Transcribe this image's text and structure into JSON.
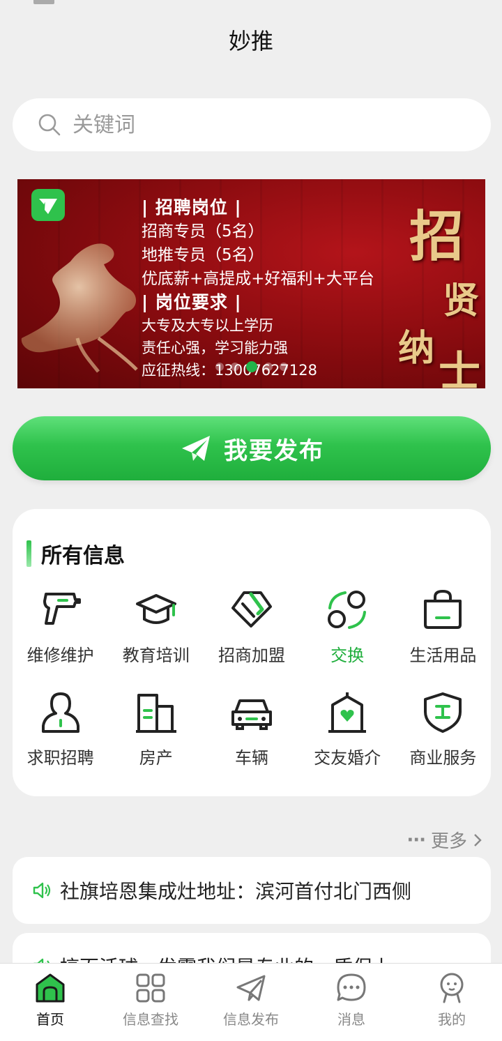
{
  "app": {
    "title": "妙推"
  },
  "search": {
    "placeholder": "关键词"
  },
  "banner": {
    "heading1": "| 招聘岗位 |",
    "line1": "招商专员（5名）",
    "line2": "地推专员（5名）",
    "line3": "优底薪+高提成+好福利+大平台",
    "heading2": "| 岗位要求 |",
    "line4": "大专及大专以上学历",
    "line5": "责任心强，学习能力强",
    "hotline": "应征热线：13007627128",
    "calligraphy": [
      "招",
      "贤",
      "纳",
      "士"
    ],
    "slide_count": 5,
    "active_slide": 2
  },
  "publish": {
    "label": "我要发布"
  },
  "categories": {
    "title": "所有信息",
    "items": [
      {
        "label": "维修维护",
        "icon": "drill-icon"
      },
      {
        "label": "教育培训",
        "icon": "graduation-cap-icon"
      },
      {
        "label": "招商加盟",
        "icon": "handshake-icon"
      },
      {
        "label": "交换",
        "icon": "exchange-icon",
        "highlighted": true
      },
      {
        "label": "生活用品",
        "icon": "shopping-bag-icon"
      },
      {
        "label": "求职招聘",
        "icon": "person-icon"
      },
      {
        "label": "房产",
        "icon": "building-icon"
      },
      {
        "label": "车辆",
        "icon": "car-icon"
      },
      {
        "label": "交友婚介",
        "icon": "heart-house-icon"
      },
      {
        "label": "商业服务",
        "icon": "shield-icon"
      }
    ]
  },
  "more": {
    "label": "更多"
  },
  "notices": [
    {
      "text": "社旗培恩集成灶地址：滨河首付北门西侧"
    },
    {
      "text": "搞百活球，发霉我们是专业的，质保上"
    }
  ],
  "tabbar": {
    "items": [
      {
        "label": "首页",
        "active": true
      },
      {
        "label": "信息查找"
      },
      {
        "label": "信息发布"
      },
      {
        "label": "消息"
      },
      {
        "label": "我的"
      }
    ]
  },
  "colors": {
    "accent": "#2fc24c",
    "banner_red": "#8d0c10",
    "background": "#efefef"
  }
}
